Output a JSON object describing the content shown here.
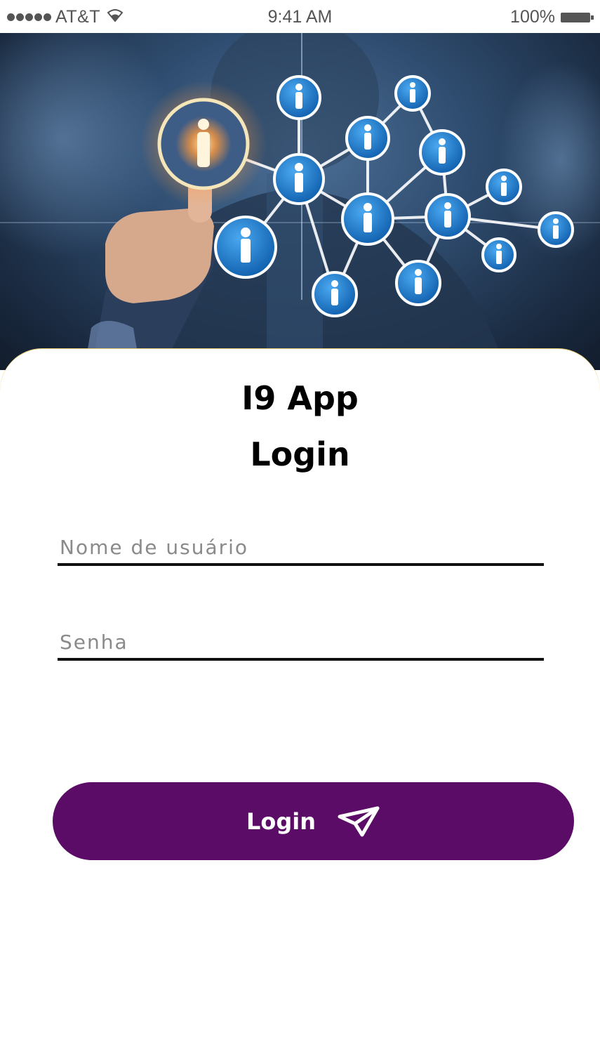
{
  "status_bar": {
    "carrier": "AT&T",
    "time": "9:41 AM",
    "battery": "100%"
  },
  "hero": {
    "icon": "people-network-icon"
  },
  "title": {
    "line1": "I9 App",
    "line2": "Login"
  },
  "form": {
    "username_placeholder": "Nome de usuário",
    "username_value": "",
    "password_placeholder": "Senha",
    "password_value": ""
  },
  "login_button": {
    "label": "Login",
    "icon": "send-icon"
  },
  "colors": {
    "button": "#5b0c66",
    "card_border": "#e8c96a",
    "network_node": "#1f7fd0"
  }
}
